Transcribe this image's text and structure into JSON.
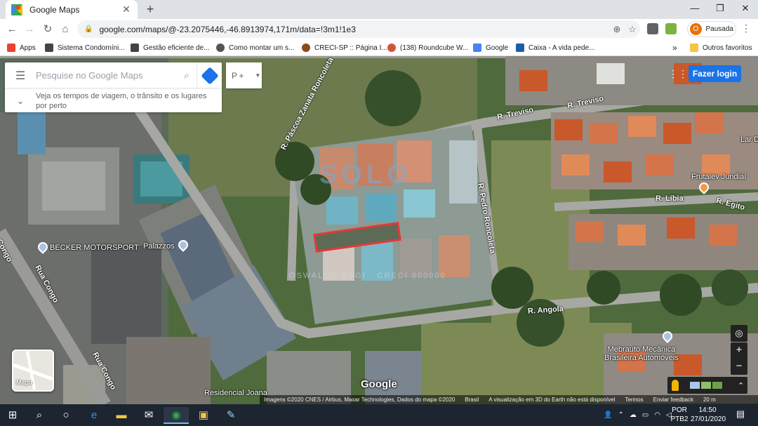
{
  "browser": {
    "tab_title": "Google Maps",
    "tab_close": "✕",
    "new_tab": "+",
    "window_controls": {
      "minimize": "—",
      "maximize": "❐",
      "close": "✕"
    },
    "url": "google.com/maps/@-23.2075446,-46.8913974,171m/data=!3m1!1e3",
    "profile_initial": "O",
    "profile_label": "Pausada",
    "menu": "⋮"
  },
  "bookmarks": [
    {
      "label": "Apps",
      "color": "#ea4335"
    },
    {
      "label": "Sistema Condomíni...",
      "color": "#444444"
    },
    {
      "label": "Gestão eficiente de...",
      "color": "#444444"
    },
    {
      "label": "Como montar um s...",
      "color": "#555555"
    },
    {
      "label": "CRECI-SP :: Página I...",
      "color": "#8a4b1c"
    },
    {
      "label": "(138) Roundcube W...",
      "color": "#d2553a"
    },
    {
      "label": "Google",
      "color": "#4285f4"
    },
    {
      "label": "Caixa - A vida pede...",
      "color": "#1a5fa8"
    }
  ],
  "bookmarks_overflow": "»",
  "bookmarks_other": "Outros favoritos",
  "maps": {
    "search_placeholder": "Pesquise no Google Maps",
    "hint": "Veja os tempos de viagem, o trânsito e os lugares por perto",
    "restaurant_label": "P​ +",
    "login": "Fazer login",
    "map_toggle_label": "Mapa",
    "google_logo": "Google",
    "attribution": [
      "Imagens ©2020 CNES / Airbus, Maxar Technologies, Dados do mapa ©2020",
      "Brasil",
      "A visualização em 3D do Earth não está disponível",
      "Termos",
      "Enviar feedback",
      "20 m"
    ],
    "roads": {
      "treviso_1": "R. Treviso",
      "treviso_2": "R. Treviso",
      "pascoa": "R. Páscoa Zanata Roncoleta",
      "pedro": "R. Pedro Roncoleta",
      "libia": "R. Líbia",
      "egito": "R. Egito",
      "angola": "R. Angola",
      "congo_1": "Rua Congo",
      "congo_2": "Rua Congo",
      "congo_3": "Rua Congo"
    },
    "pois": {
      "becker": "BECKER MOTORSPORT",
      "palazzos": "Palazzos",
      "frutalev": "Frutalev Jundiaí",
      "mebrauto": "Mebrauto Mecânica\nBrasileira Automóveis",
      "residencial": "Residencial Joana",
      "lar": "Lar D"
    },
    "watermark_top": "SOLO",
    "watermark_bottom": "OSWALDO AGGI · CRECI 000000"
  },
  "taskbar": {
    "lang_top": "POR",
    "lang_bottom": "PTB2",
    "time": "14:50",
    "date": "27/01/2020"
  }
}
